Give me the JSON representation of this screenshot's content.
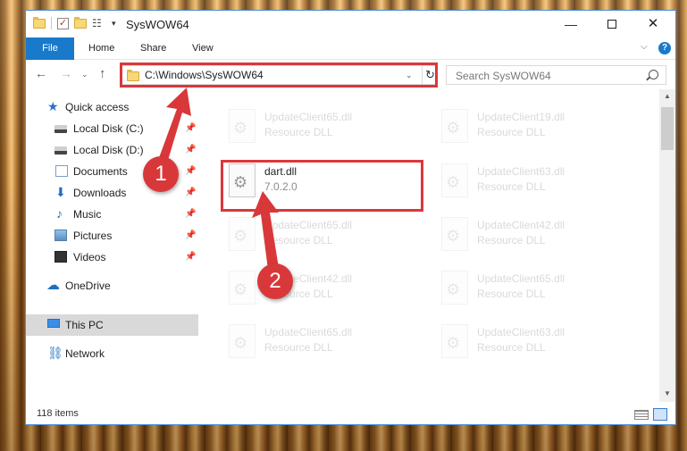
{
  "window": {
    "title": "SysWOW64",
    "minimize_glyph": "—",
    "close_glyph": "✕"
  },
  "qat": {
    "check_glyph": "✓",
    "props_glyph": "☷",
    "dropdown_glyph": "▾"
  },
  "ribbon": {
    "tabs": [
      "File",
      "Home",
      "Share",
      "View"
    ],
    "chevron_glyph": "⌵",
    "help_glyph": "?"
  },
  "navbar": {
    "back_glyph": "←",
    "forward_glyph": "→",
    "recent_glyph": "⌄",
    "up_glyph": "↑",
    "address": "C:\\Windows\\SysWOW64",
    "address_dropdown_glyph": "⌄",
    "refresh_glyph": "↻",
    "search_placeholder": "Search SysWOW64"
  },
  "nav_pane": {
    "pin_glyph": "📌",
    "items": [
      {
        "label": "Quick access",
        "icon": "star-icon",
        "glyph": "★"
      },
      {
        "label": "Local Disk (C:)",
        "icon": "drive-icon",
        "pinned": true
      },
      {
        "label": "Local Disk (D:)",
        "icon": "drive-icon",
        "pinned": true
      },
      {
        "label": "Documents",
        "icon": "documents-icon",
        "pinned": true
      },
      {
        "label": "Downloads",
        "icon": "downloads-icon",
        "glyph": "⬇",
        "pinned": true
      },
      {
        "label": "Music",
        "icon": "music-icon",
        "glyph": "♪",
        "pinned": true
      },
      {
        "label": "Pictures",
        "icon": "pictures-icon",
        "pinned": true
      },
      {
        "label": "Videos",
        "icon": "videos-icon",
        "pinned": true
      },
      {
        "label": "OneDrive",
        "icon": "onedrive-icon",
        "glyph": "☁"
      },
      {
        "label": "This PC",
        "icon": "computer-icon",
        "selected": true
      },
      {
        "label": "Network",
        "icon": "network-icon",
        "glyph": "⛓"
      }
    ]
  },
  "files": [
    {
      "name": "UpdateClient65.dll",
      "desc": "Resource DLL",
      "faded": true
    },
    {
      "name": "UpdateClient19.dll",
      "desc": "Resource DLL",
      "faded": true
    },
    {
      "name": "dart.dll",
      "desc": "7.0.2.0",
      "faded": false
    },
    {
      "name": "UpdateClient63.dll",
      "desc": "Resource DLL",
      "faded": true
    },
    {
      "name": "UpdateClient65.dll",
      "desc": "Resource DLL",
      "faded": true
    },
    {
      "name": "UpdateClient42.dll",
      "desc": "Resource DLL",
      "faded": true
    },
    {
      "name": "UpdateClient42.dll",
      "desc": "Resource DLL",
      "faded": true
    },
    {
      "name": "UpdateClient65.dll",
      "desc": "Resource DLL",
      "faded": true
    },
    {
      "name": "UpdateClient65.dll",
      "desc": "Resource DLL",
      "faded": true
    },
    {
      "name": "UpdateClient63.dll",
      "desc": "Resource DLL",
      "faded": true
    }
  ],
  "scrollbar": {
    "up_glyph": "▲",
    "down_glyph": "▼"
  },
  "status": {
    "item_count": "118 items"
  },
  "annotations": {
    "callout_1": "1",
    "callout_2": "2",
    "color": "#d9383a"
  }
}
